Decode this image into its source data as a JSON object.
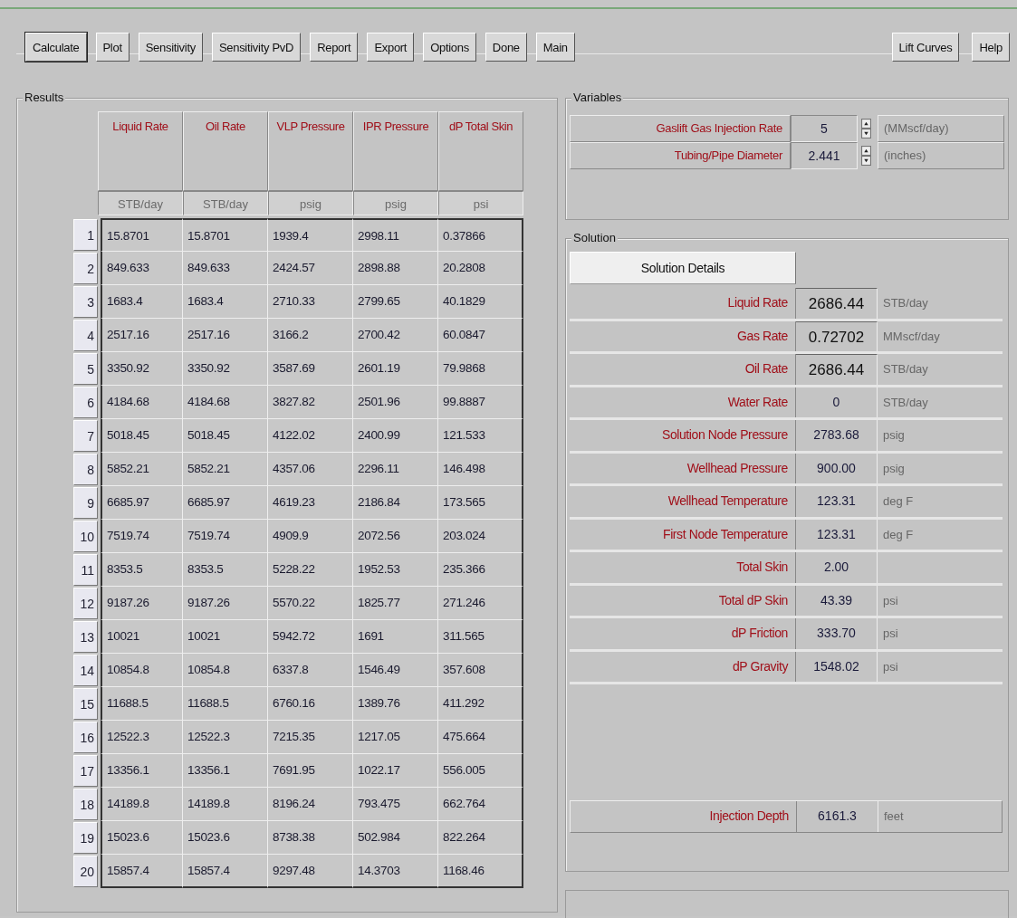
{
  "toolbar": {
    "left_buttons": [
      "Calculate",
      "Plot",
      "Sensitivity",
      "Sensitivity PvD",
      "Report",
      "Export",
      "Options",
      "Done",
      "Main"
    ],
    "right_buttons": [
      "Lift Curves",
      "Help"
    ]
  },
  "results": {
    "title": "Results",
    "columns": [
      {
        "label": "Liquid Rate",
        "unit": "STB/day"
      },
      {
        "label": "Oil Rate",
        "unit": "STB/day"
      },
      {
        "label": "VLP Pressure",
        "unit": "psig"
      },
      {
        "label": "IPR Pressure",
        "unit": "psig"
      },
      {
        "label": "dP Total Skin",
        "unit": "psi"
      }
    ],
    "rows": [
      {
        "number": "1",
        "cells": [
          "15.8701",
          "15.8701",
          "1939.4",
          "2998.11",
          "0.37866"
        ]
      },
      {
        "number": "2",
        "cells": [
          "849.633",
          "849.633",
          "2424.57",
          "2898.88",
          "20.2808"
        ]
      },
      {
        "number": "3",
        "cells": [
          "1683.4",
          "1683.4",
          "2710.33",
          "2799.65",
          "40.1829"
        ]
      },
      {
        "number": "4",
        "cells": [
          "2517.16",
          "2517.16",
          "3166.2",
          "2700.42",
          "60.0847"
        ]
      },
      {
        "number": "5",
        "cells": [
          "3350.92",
          "3350.92",
          "3587.69",
          "2601.19",
          "79.9868"
        ]
      },
      {
        "number": "6",
        "cells": [
          "4184.68",
          "4184.68",
          "3827.82",
          "2501.96",
          "99.8887"
        ]
      },
      {
        "number": "7",
        "cells": [
          "5018.45",
          "5018.45",
          "4122.02",
          "2400.99",
          "121.533"
        ]
      },
      {
        "number": "8",
        "cells": [
          "5852.21",
          "5852.21",
          "4357.06",
          "2296.11",
          "146.498"
        ]
      },
      {
        "number": "9",
        "cells": [
          "6685.97",
          "6685.97",
          "4619.23",
          "2186.84",
          "173.565"
        ]
      },
      {
        "number": "10",
        "cells": [
          "7519.74",
          "7519.74",
          "4909.9",
          "2072.56",
          "203.024"
        ]
      },
      {
        "number": "11",
        "cells": [
          "8353.5",
          "8353.5",
          "5228.22",
          "1952.53",
          "235.366"
        ]
      },
      {
        "number": "12",
        "cells": [
          "9187.26",
          "9187.26",
          "5570.22",
          "1825.77",
          "271.246"
        ]
      },
      {
        "number": "13",
        "cells": [
          "10021",
          "10021",
          "5942.72",
          "1691",
          "311.565"
        ]
      },
      {
        "number": "14",
        "cells": [
          "10854.8",
          "10854.8",
          "6337.8",
          "1546.49",
          "357.608"
        ]
      },
      {
        "number": "15",
        "cells": [
          "11688.5",
          "11688.5",
          "6760.16",
          "1389.76",
          "411.292"
        ]
      },
      {
        "number": "16",
        "cells": [
          "12522.3",
          "12522.3",
          "7215.35",
          "1217.05",
          "475.664"
        ]
      },
      {
        "number": "17",
        "cells": [
          "13356.1",
          "13356.1",
          "7691.95",
          "1022.17",
          "556.005"
        ]
      },
      {
        "number": "18",
        "cells": [
          "14189.8",
          "14189.8",
          "8196.24",
          "793.475",
          "662.764"
        ]
      },
      {
        "number": "19",
        "cells": [
          "15023.6",
          "15023.6",
          "8738.38",
          "502.984",
          "822.264"
        ]
      },
      {
        "number": "20",
        "cells": [
          "15857.4",
          "15857.4",
          "9297.48",
          "14.3703",
          "1168.46"
        ]
      }
    ]
  },
  "variables": {
    "title": "Variables",
    "items": [
      {
        "label": "Gaslift Gas Injection Rate",
        "value": "5",
        "unit": "(MMscf/day)"
      },
      {
        "label": "Tubing/Pipe Diameter",
        "value": "2.441",
        "unit": "(inches)"
      }
    ]
  },
  "solution": {
    "title": "Solution",
    "details_button": "Solution Details",
    "items": [
      {
        "label": "Liquid Rate",
        "value": "2686.44",
        "unit": "STB/day",
        "kind": "primary"
      },
      {
        "label": "Gas Rate",
        "value": "0.72702",
        "unit": "MMscf/day",
        "kind": "primary"
      },
      {
        "label": "Oil Rate",
        "value": "2686.44",
        "unit": "STB/day",
        "kind": "primary"
      },
      {
        "label": "Water Rate",
        "value": "0",
        "unit": "STB/day",
        "kind": "plain"
      },
      {
        "label": "Solution Node Pressure",
        "value": "2783.68",
        "unit": "psig",
        "kind": "plain"
      },
      {
        "label": "Wellhead Pressure",
        "value": "900.00",
        "unit": "psig",
        "kind": "plain"
      },
      {
        "label": "Wellhead Temperature",
        "value": "123.31",
        "unit": "deg F",
        "kind": "plain"
      },
      {
        "label": "First Node Temperature",
        "value": "123.31",
        "unit": "deg F",
        "kind": "plain"
      },
      {
        "label": "Total Skin",
        "value": "2.00",
        "kind": "plain"
      },
      {
        "label": "Total dP Skin",
        "value": "43.39",
        "unit": "psi",
        "kind": "plain"
      },
      {
        "label": "dP Friction",
        "value": "333.70",
        "unit": "psi",
        "kind": "plain"
      },
      {
        "label": "dP Gravity",
        "value": "1548.02",
        "unit": "psi",
        "kind": "plain"
      }
    ],
    "injection": {
      "label": "Injection Depth",
      "value": "6161.3",
      "unit": "feet"
    }
  }
}
